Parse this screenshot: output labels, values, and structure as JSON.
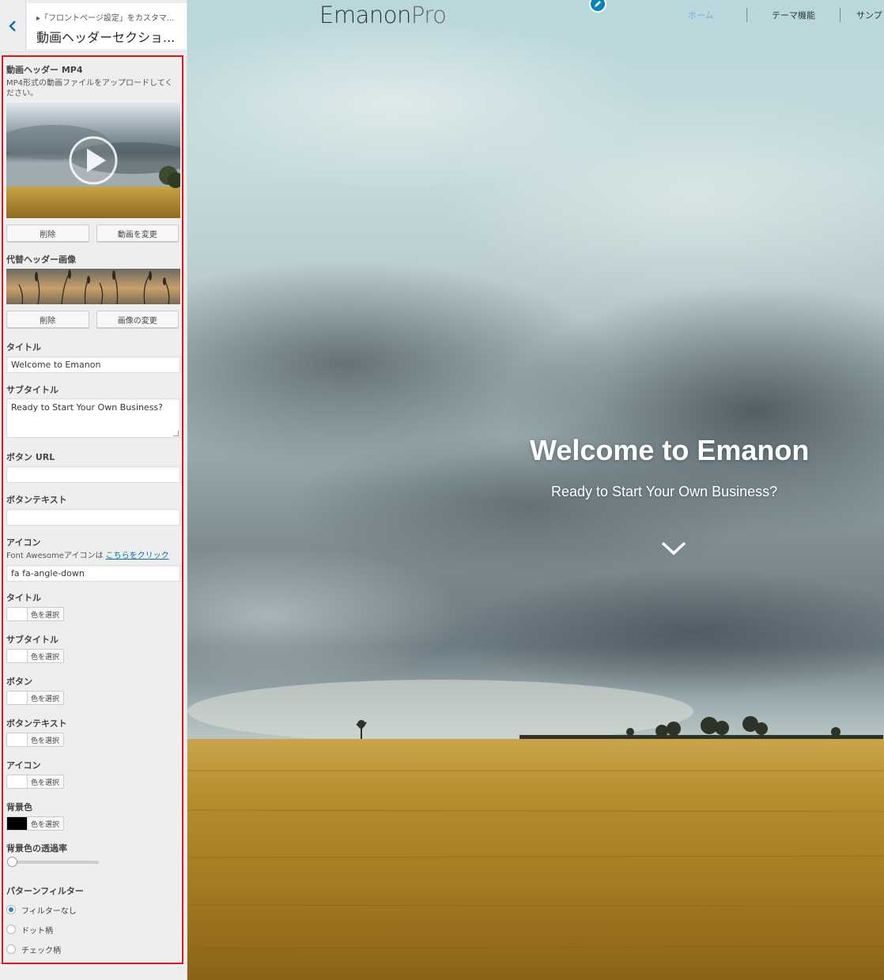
{
  "sidebar": {
    "breadcrumb": "▸「フロントページ設定」をカスタマ...",
    "section_title": "動画ヘッダーセクショ...",
    "video": {
      "label": "動画ヘッダー MP4",
      "description": "MP4形式の動画ファイルをアップロードしてください。",
      "remove_label": "削除",
      "change_label": "動画を変更"
    },
    "alt_image": {
      "label": "代替ヘッダー画像",
      "remove_label": "削除",
      "change_label": "画像の変更"
    },
    "title_field": {
      "label": "タイトル",
      "value": "Welcome to Emanon"
    },
    "subtitle_field": {
      "label": "サブタイトル",
      "value": "Ready to Start Your Own Business?"
    },
    "button_url": {
      "label": "ボタン URL",
      "value": ""
    },
    "button_text": {
      "label": "ボタンテキスト",
      "value": ""
    },
    "icon_field": {
      "label": "アイコン",
      "description_prefix": "Font Awesomeアイコンは",
      "link_text": "こちらをクリック",
      "value": "fa fa-angle-down"
    },
    "colors": [
      {
        "label": "タイトル",
        "button": "色を選択",
        "swatch": "#ffffff"
      },
      {
        "label": "サブタイトル",
        "button": "色を選択",
        "swatch": "#ffffff"
      },
      {
        "label": "ボタン",
        "button": "色を選択",
        "swatch": "#ffffff"
      },
      {
        "label": "ボタンテキスト",
        "button": "色を選択",
        "swatch": "#ffffff"
      },
      {
        "label": "アイコン",
        "button": "色を選択",
        "swatch": "#ffffff"
      },
      {
        "label": "背景色",
        "button": "色を選択",
        "swatch": "#000000"
      }
    ],
    "opacity": {
      "label": "背景色の透過率",
      "value": 0
    },
    "pattern_filter": {
      "label": "パターンフィルター",
      "options": [
        "フィルターなし",
        "ドット柄",
        "チェック柄"
      ],
      "selected": "フィルターなし"
    }
  },
  "preview": {
    "logo_main": "Emanon",
    "logo_pro": "Pro",
    "nav": [
      "ホーム",
      "テーマ機能",
      "サンプ"
    ],
    "hero_title": "Welcome to Emanon",
    "hero_subtitle": "Ready to Start Your Own Business?",
    "hero_icon": "angle-down-icon",
    "accent_color": "#0073aa",
    "highlight_border_color": "#e0141a"
  }
}
